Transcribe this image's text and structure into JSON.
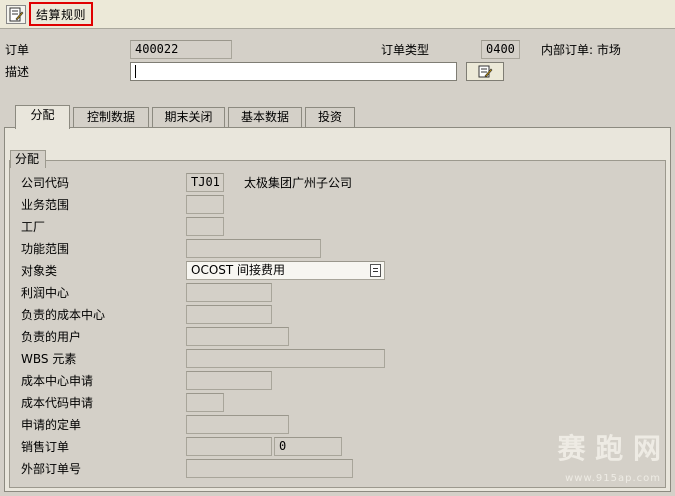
{
  "toolbar": {
    "settle_rule_label": "结算规则"
  },
  "header": {
    "order_label": "订单",
    "order_value": "400022",
    "order_type_label": "订单类型",
    "order_type_value": "0400",
    "internal_order_text": "内部订单: 市场",
    "desc_label": "描述",
    "desc_value": ""
  },
  "tabs": [
    {
      "label": "分配",
      "active": true
    },
    {
      "label": "控制数据",
      "active": false
    },
    {
      "label": "期末关闭",
      "active": false
    },
    {
      "label": "基本数据",
      "active": false
    },
    {
      "label": "投资",
      "active": false
    }
  ],
  "group": {
    "title": "分配",
    "rows": [
      {
        "label": "公司代码",
        "value": "TJ01",
        "extra": "太极集团广州子公司"
      },
      {
        "label": "业务范围",
        "value": ""
      },
      {
        "label": "工厂",
        "value": ""
      },
      {
        "label": "功能范围",
        "value": ""
      },
      {
        "label": "对象类",
        "value": "OCOST 间接费用"
      },
      {
        "label": "利润中心",
        "value": ""
      },
      {
        "label": "负责的成本中心",
        "value": ""
      },
      {
        "label": "负责的用户",
        "value": ""
      },
      {
        "label": "WBS 元素",
        "value": ""
      },
      {
        "label": "成本中心申请",
        "value": ""
      },
      {
        "label": "成本代码申请",
        "value": ""
      },
      {
        "label": "申请的定单",
        "value": ""
      },
      {
        "label": "销售订单",
        "value": "",
        "value2": "0"
      },
      {
        "label": "外部订单号",
        "value": ""
      }
    ]
  },
  "watermark": {
    "main": "赛 跑 网",
    "sub": "www.915ap.com"
  }
}
